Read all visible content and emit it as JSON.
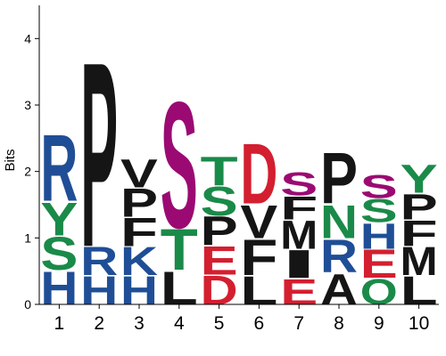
{
  "colors": {
    "blue": "#1f4e96",
    "green": "#1a8a49",
    "black": "#151515",
    "purple": "#9b0a72",
    "red": "#d31f30"
  },
  "chart_data": {
    "type": "sequence-logo",
    "ylabel": "Bits",
    "ylim": [
      0,
      4.5
    ],
    "y_ticks": [
      "0",
      "1",
      "2",
      "3",
      "4"
    ],
    "positions": [
      "1",
      "2",
      "3",
      "4",
      "5",
      "6",
      "7",
      "8",
      "9",
      "10"
    ],
    "stacks": [
      {
        "position": "1",
        "letters": [
          {
            "letter": "H",
            "height": 0.52,
            "color": "blue"
          },
          {
            "letter": "S",
            "height": 0.52,
            "color": "green"
          },
          {
            "letter": "Y",
            "height": 0.52,
            "color": "green"
          },
          {
            "letter": "R",
            "height": 1.04,
            "color": "blue"
          }
        ]
      },
      {
        "position": "2",
        "letters": [
          {
            "letter": "H",
            "height": 0.44,
            "color": "blue"
          },
          {
            "letter": "R",
            "height": 0.44,
            "color": "blue"
          },
          {
            "letter": "P",
            "height": 2.9,
            "color": "black"
          }
        ]
      },
      {
        "position": "3",
        "letters": [
          {
            "letter": "H",
            "height": 0.44,
            "color": "blue"
          },
          {
            "letter": "K",
            "height": 0.44,
            "color": "blue"
          },
          {
            "letter": "F",
            "height": 0.44,
            "color": "black"
          },
          {
            "letter": "P",
            "height": 0.44,
            "color": "black"
          },
          {
            "letter": "V",
            "height": 0.44,
            "color": "black"
          }
        ]
      },
      {
        "position": "4",
        "letters": [
          {
            "letter": "L",
            "height": 0.52,
            "color": "black"
          },
          {
            "letter": "T",
            "height": 0.64,
            "color": "green"
          },
          {
            "letter": "S",
            "height": 1.98,
            "color": "purple"
          }
        ]
      },
      {
        "position": "5",
        "letters": [
          {
            "letter": "D",
            "height": 0.45,
            "color": "red"
          },
          {
            "letter": "E",
            "height": 0.44,
            "color": "red"
          },
          {
            "letter": "P",
            "height": 0.45,
            "color": "black"
          },
          {
            "letter": "S",
            "height": 0.45,
            "color": "green"
          },
          {
            "letter": "T",
            "height": 0.45,
            "color": "green"
          }
        ]
      },
      {
        "position": "6",
        "letters": [
          {
            "letter": "L",
            "height": 0.44,
            "color": "black"
          },
          {
            "letter": "F",
            "height": 0.56,
            "color": "black"
          },
          {
            "letter": "V",
            "height": 0.52,
            "color": "black"
          },
          {
            "letter": "D",
            "height": 0.94,
            "color": "red"
          }
        ]
      },
      {
        "position": "7",
        "letters": [
          {
            "letter": "E",
            "height": 0.4,
            "color": "red"
          },
          {
            "letter": "I",
            "height": 0.44,
            "color": "black"
          },
          {
            "letter": "M",
            "height": 0.44,
            "color": "black"
          },
          {
            "letter": "F",
            "height": 0.36,
            "color": "black"
          },
          {
            "letter": "S",
            "height": 0.36,
            "color": "purple"
          }
        ]
      },
      {
        "position": "8",
        "letters": [
          {
            "letter": "A",
            "height": 0.48,
            "color": "black"
          },
          {
            "letter": "R",
            "height": 0.52,
            "color": "blue"
          },
          {
            "letter": "N",
            "height": 0.52,
            "color": "green"
          },
          {
            "letter": "P",
            "height": 0.8,
            "color": "black"
          }
        ]
      },
      {
        "position": "9",
        "letters": [
          {
            "letter": "Q",
            "height": 0.4,
            "color": "green"
          },
          {
            "letter": "E",
            "height": 0.44,
            "color": "red"
          },
          {
            "letter": "H",
            "height": 0.4,
            "color": "blue"
          },
          {
            "letter": "S",
            "height": 0.36,
            "color": "green"
          },
          {
            "letter": "S",
            "height": 0.36,
            "color": "purple"
          }
        ]
      },
      {
        "position": "10",
        "letters": [
          {
            "letter": "L",
            "height": 0.44,
            "color": "black"
          },
          {
            "letter": "M",
            "height": 0.44,
            "color": "black"
          },
          {
            "letter": "F",
            "height": 0.4,
            "color": "black"
          },
          {
            "letter": "P",
            "height": 0.4,
            "color": "black"
          },
          {
            "letter": "Y",
            "height": 0.44,
            "color": "green"
          }
        ]
      }
    ]
  }
}
